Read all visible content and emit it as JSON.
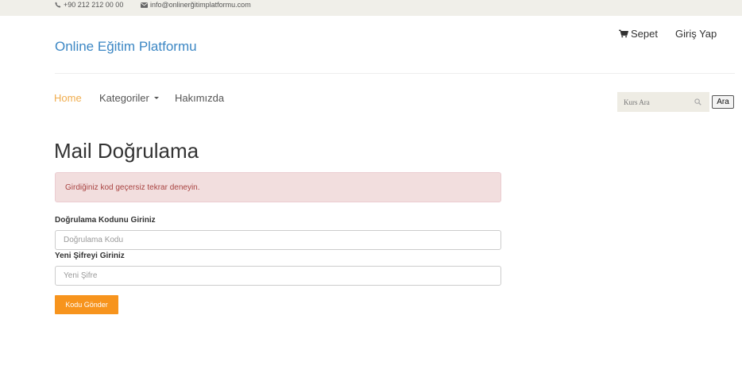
{
  "topbar": {
    "phone": "+90 212 212 00 00",
    "email": "info@onlinerğitimplatformu.com"
  },
  "header": {
    "brand": "Online Eğitim Platformu",
    "cart_label": "Sepet",
    "login_label": "Giriş Yap"
  },
  "nav": {
    "items": [
      {
        "label": "Home",
        "active": true
      },
      {
        "label": "Kategoriler",
        "has_dropdown": true
      },
      {
        "label": "Hakımızda"
      }
    ]
  },
  "search": {
    "placeholder": "Kurs Ara",
    "button_label": "Ara"
  },
  "main": {
    "title": "Mail Doğrulama",
    "alert_text": "Girdiğiniz kod geçersiz tekrar deneyin.",
    "code_label": "Doğrulama Kodunu Giriniz",
    "code_placeholder": "Doğrulama Kodu",
    "password_label": "Yeni Şifreyi Giriniz",
    "password_placeholder": "Yeni Şifre",
    "submit_label": "Kodu Gönder"
  },
  "colors": {
    "accent": "#f7941d",
    "brand": "#3c87c4",
    "active_nav": "#f0ad4e",
    "alert_bg": "#f2dede",
    "alert_text": "#a94442",
    "topbar_bg": "#f0efe9"
  },
  "icons": {
    "phone": "phone-icon",
    "email": "envelope-icon",
    "cart": "cart-icon",
    "search": "search-icon",
    "dropdown": "caret-down-icon"
  }
}
